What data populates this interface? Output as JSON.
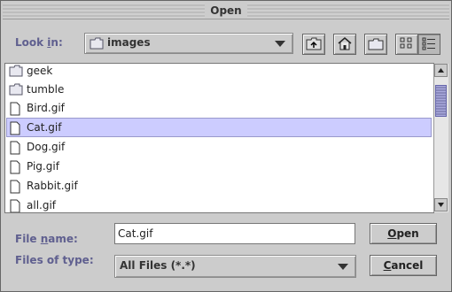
{
  "window": {
    "title": "Open"
  },
  "look_in": {
    "label_prefix": "Look ",
    "label_mnemonic": "i",
    "label_suffix": "n:",
    "value": "images"
  },
  "toolbar": {
    "buttons": [
      {
        "icon": "up-folder-icon"
      },
      {
        "icon": "home-icon"
      },
      {
        "icon": "new-folder-icon"
      },
      {
        "icon": "list-view-icon"
      },
      {
        "icon": "details-view-icon",
        "selected": true
      }
    ]
  },
  "files": [
    {
      "name": "geek",
      "type": "folder"
    },
    {
      "name": "tumble",
      "type": "folder"
    },
    {
      "name": "Bird.gif",
      "type": "file"
    },
    {
      "name": "Cat.gif",
      "type": "file",
      "selected": true
    },
    {
      "name": "Dog.gif",
      "type": "file"
    },
    {
      "name": "Pig.gif",
      "type": "file"
    },
    {
      "name": "Rabbit.gif",
      "type": "file"
    },
    {
      "name": "all.gif",
      "type": "file"
    }
  ],
  "file_name": {
    "label_prefix": "File ",
    "label_mnemonic": "n",
    "label_suffix": "ame:",
    "value": "Cat.gif"
  },
  "files_of_type": {
    "label": "Files of type:",
    "value": "All Files (*.*)"
  },
  "buttons": {
    "open_mnemonic": "O",
    "open_rest": "pen",
    "cancel_mnemonic": "C",
    "cancel_rest": "ancel"
  },
  "colors": {
    "label": "#5f5f8f",
    "selection": "#ccccff",
    "scroll_thumb": "#9999cc"
  }
}
